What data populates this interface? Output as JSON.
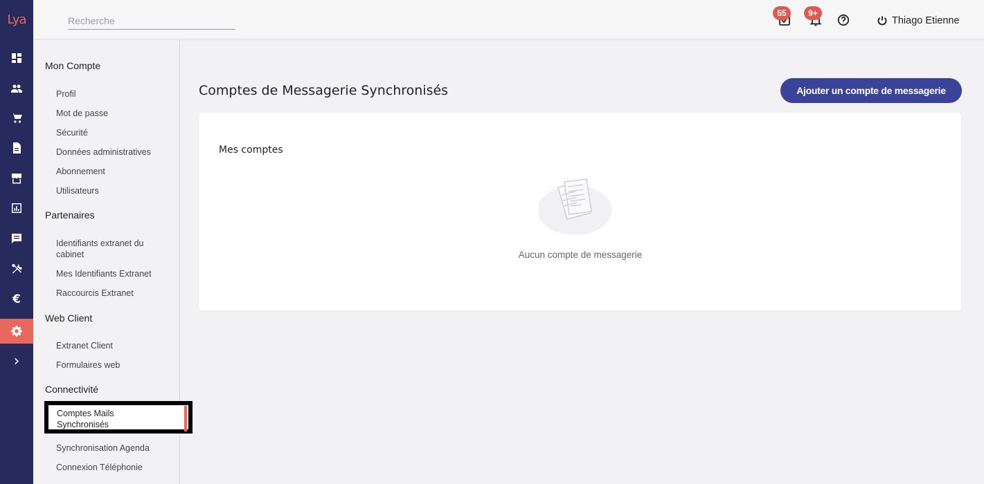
{
  "app": {
    "logo_text": "Lya"
  },
  "search": {
    "placeholder": "Recherche"
  },
  "topbar": {
    "tasks_badge": "55",
    "notifications_badge": "9+",
    "user_name": "Thiago Etienne"
  },
  "rail": {
    "items": [
      {
        "icon": "dashboard-icon"
      },
      {
        "icon": "people-icon"
      },
      {
        "icon": "cart-icon"
      },
      {
        "icon": "document-icon"
      },
      {
        "icon": "store-icon"
      },
      {
        "icon": "chart-icon"
      },
      {
        "icon": "chat-icon"
      },
      {
        "icon": "tools-icon"
      },
      {
        "icon": "euro-icon",
        "glyph": "€"
      },
      {
        "icon": "gear-icon",
        "active": true
      },
      {
        "icon": "chevron-right-icon",
        "glyph": "›"
      }
    ],
    "active_color": "#e8675f",
    "background": "#262a5c"
  },
  "menu": {
    "sections": [
      {
        "title": "Mon Compte",
        "items": [
          "Profil",
          "Mot de passe",
          "Sécurité",
          "Données administratives",
          "Abonnement",
          "Utilisateurs"
        ]
      },
      {
        "title": "Partenaires",
        "items": [
          "Identifiants extranet du cabinet",
          "Mes Identifiants Extranet",
          "Raccourcis Extranet"
        ]
      },
      {
        "title": "Web Client",
        "items": [
          "Extranet Client",
          "Formulaires web"
        ]
      },
      {
        "title": "Connectivité",
        "items": [
          "Comptes Mails Synchronisés",
          "Synchronisation Agenda",
          "Connexion Téléphonie"
        ]
      }
    ],
    "selected_item": "Comptes Mails Synchronisés"
  },
  "main": {
    "title": "Comptes de Messagerie Synchronisés",
    "add_button": "Ajouter un compte de messagerie",
    "card_title": "Mes comptes",
    "empty_text": "Aucun compte de messagerie"
  },
  "colors": {
    "primary": "#3b4399",
    "accent": "#e8675f",
    "badge": "#e05a52"
  }
}
